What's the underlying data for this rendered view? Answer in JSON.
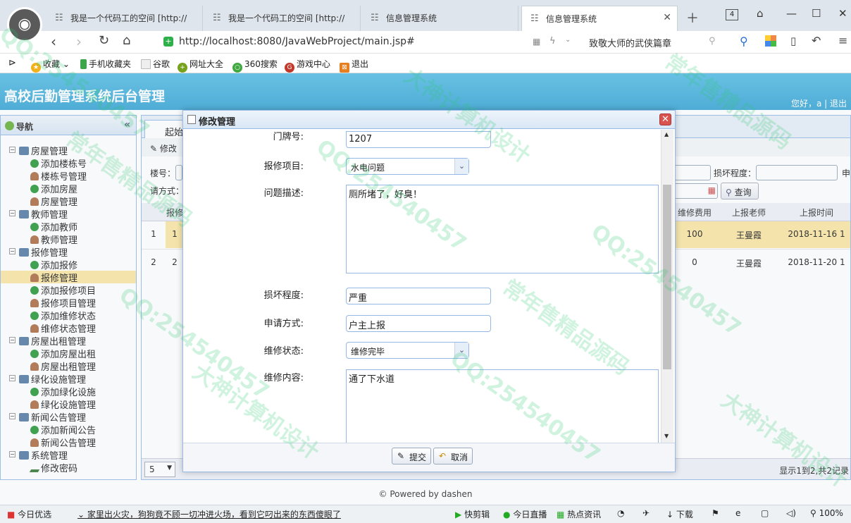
{
  "browser": {
    "tabs": [
      {
        "label": "我是一个代码工的空间 [http://"
      },
      {
        "label": "我是一个代码工的空间 [http://"
      },
      {
        "label": "信息管理系统"
      },
      {
        "label": "信息管理系统"
      }
    ],
    "tab_count": "4",
    "url": "http://localhost:8080/JavaWebProject/main.jsp#",
    "search_text": "致敬大师的武侠篇章",
    "bookmarks": [
      "收藏",
      "手机收藏夹",
      "谷歌",
      "网址大全",
      "360搜索",
      "游戏中心",
      "退出"
    ]
  },
  "app": {
    "title": "高校后勤管理系统后台管理",
    "greeting": "您好，a | 退出",
    "nav_title": "导航",
    "start_tab": "起始",
    "toolbar_edit": "修改",
    "filters": {
      "building": "楼号：",
      "damage": "损坏程度：",
      "method": "请方式：",
      "by_suffix": "申",
      "query": "查询"
    },
    "tree": [
      {
        "label": "房屋管理",
        "level": 0
      },
      {
        "label": "添加楼栋号",
        "level": 1,
        "icon": "add"
      },
      {
        "label": "楼栋号管理",
        "level": 1,
        "icon": "user"
      },
      {
        "label": "添加房屋",
        "level": 1,
        "icon": "add"
      },
      {
        "label": "房屋管理",
        "level": 1,
        "icon": "user"
      },
      {
        "label": "教师管理",
        "level": 0
      },
      {
        "label": "添加教师",
        "level": 1,
        "icon": "add"
      },
      {
        "label": "教师管理",
        "level": 1,
        "icon": "user"
      },
      {
        "label": "报修管理",
        "level": 0
      },
      {
        "label": "添加报修",
        "level": 1,
        "icon": "add"
      },
      {
        "label": "报修管理",
        "level": 1,
        "icon": "user",
        "selected": true
      },
      {
        "label": "添加报修项目",
        "level": 1,
        "icon": "add"
      },
      {
        "label": "报修项目管理",
        "level": 1,
        "icon": "user"
      },
      {
        "label": "添加维修状态",
        "level": 1,
        "icon": "add"
      },
      {
        "label": "维修状态管理",
        "level": 1,
        "icon": "user"
      },
      {
        "label": "房屋出租管理",
        "level": 0
      },
      {
        "label": "添加房屋出租",
        "level": 1,
        "icon": "add"
      },
      {
        "label": "房屋出租管理",
        "level": 1,
        "icon": "user"
      },
      {
        "label": "绿化设施管理",
        "level": 0
      },
      {
        "label": "添加绿化设施",
        "level": 1,
        "icon": "add"
      },
      {
        "label": "绿化设施管理",
        "level": 1,
        "icon": "user"
      },
      {
        "label": "新闻公告管理",
        "level": 0
      },
      {
        "label": "添加新闻公告",
        "level": 1,
        "icon": "add"
      },
      {
        "label": "新闻公告管理",
        "level": 1,
        "icon": "user"
      },
      {
        "label": "系统管理",
        "level": 0
      },
      {
        "label": "修改密码",
        "level": 1,
        "icon": "key"
      }
    ],
    "grid": {
      "headers": {
        "first": "报修",
        "fee": "维修费用",
        "teacher": "上报老师",
        "time": "上报时间"
      },
      "rows": [
        {
          "num": "1",
          "first": "1",
          "fee": "100",
          "teacher": "王曼霞",
          "time": "2018-11-16 1"
        },
        {
          "num": "2",
          "first": "2",
          "fee": "0",
          "teacher": "王曼霞",
          "time": "2018-11-20 1"
        }
      ]
    },
    "page_size": "5",
    "pager_text": "显示1到2,共2记录",
    "footer": "© Powered by dashen"
  },
  "dialog": {
    "title": "修改管理",
    "fields": {
      "door_label": "门牌号:",
      "door_value": "1207",
      "project_label": "报修项目:",
      "project_value": "水电问题",
      "desc_label": "问题描述:",
      "desc_value": "厕所堵了，好臭！",
      "damage_label": "损坏程度:",
      "damage_value": "严重",
      "method_label": "申请方式:",
      "method_value": "户主上报",
      "status_label": "维修状态:",
      "status_value": "维修完毕",
      "content_label": "维修内容:",
      "content_value": "通了下水道"
    },
    "submit": "提交",
    "cancel": "取消"
  },
  "statusbar": {
    "items": [
      "今日优选",
      "家里出火灾，狗狗竟不顾一切冲进火场，看到它叼出来的东西傻眼了",
      "快剪辑",
      "今日直播",
      "热点资讯",
      "下载",
      "100%"
    ]
  },
  "watermark": {
    "lines": [
      "QQ:254540457",
      "大神计算机设计",
      "常年售精品源码"
    ]
  },
  "colors": {
    "header": "#4fb5e0",
    "selected_row": "#fbe7a5",
    "accent": "#99bbe8"
  }
}
